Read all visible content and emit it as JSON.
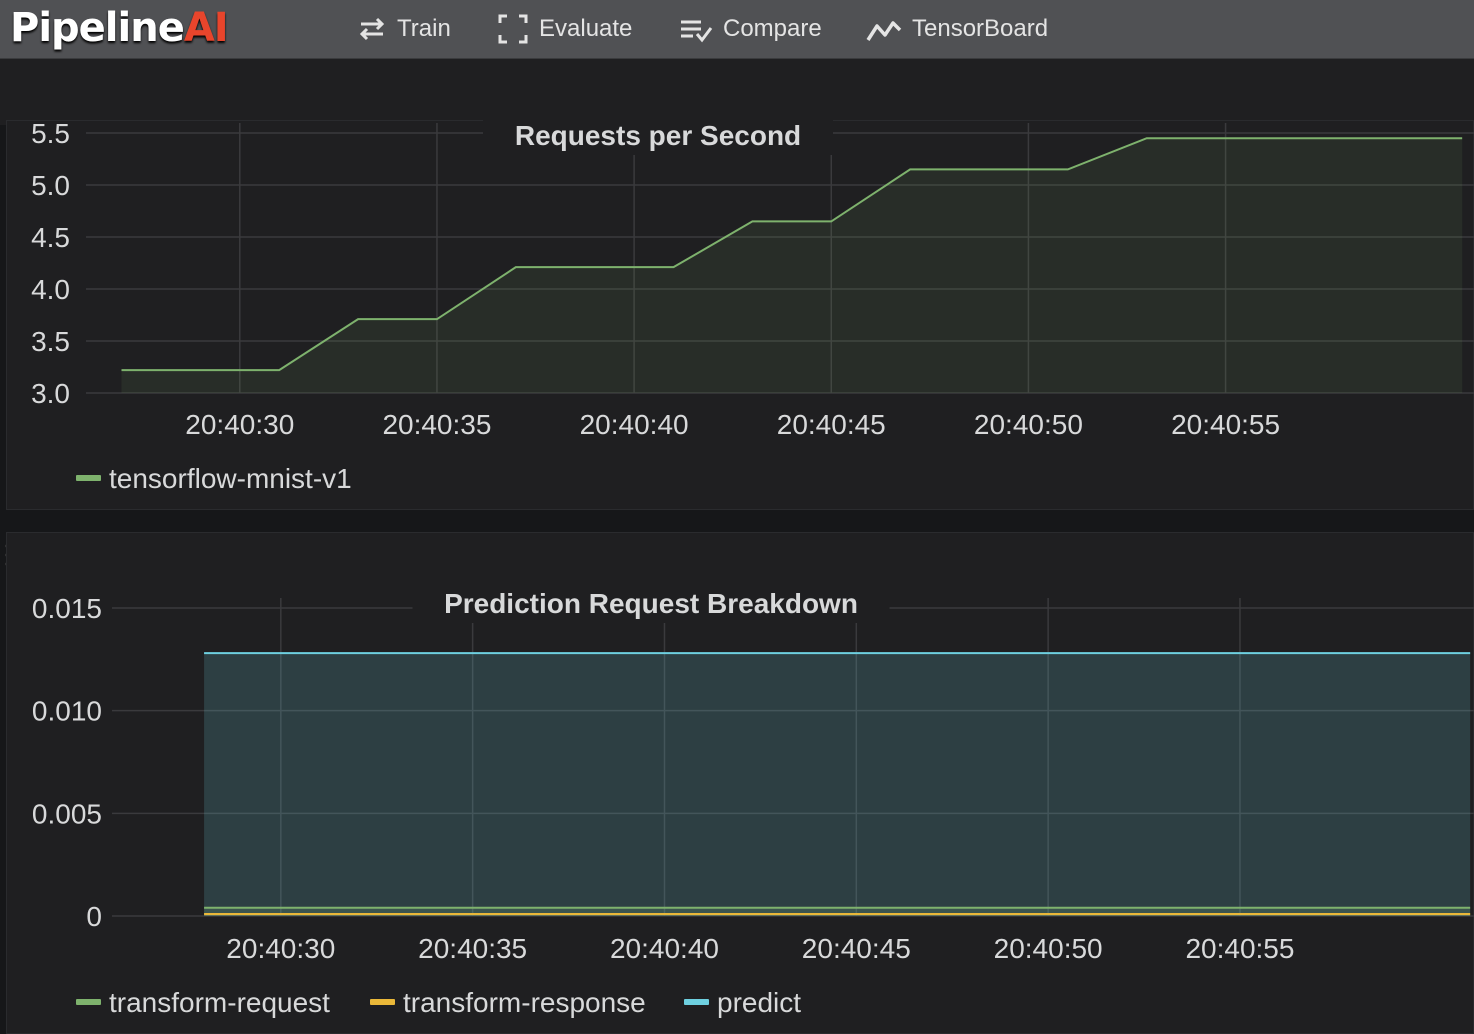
{
  "app": {
    "logo_main": "Pipeline",
    "logo_accent": "AI"
  },
  "nav": {
    "items": [
      {
        "label": "Train",
        "icon": "train-icon"
      },
      {
        "label": "Evaluate",
        "icon": "evaluate-icon"
      },
      {
        "label": "Compare",
        "icon": "compare-icon"
      },
      {
        "label": "TensorBoard",
        "icon": "tensorboard-icon"
      }
    ]
  },
  "colors": {
    "green": "#7eb26d",
    "yellow": "#eab839",
    "blue": "#6ed0e0",
    "grid": "#3a3a3d",
    "text": "#d8d9da"
  },
  "chart_data": [
    {
      "type": "area",
      "title": "Requests per Second",
      "xlabel": "",
      "ylabel": "",
      "x_ticks": [
        "20:40:30",
        "20:40:35",
        "20:40:40",
        "20:40:45",
        "20:40:50",
        "20:40:55"
      ],
      "y_ticks": [
        "3.0",
        "3.5",
        "4.0",
        "4.5",
        "5.0",
        "5.5"
      ],
      "ylim": [
        3.0,
        5.5
      ],
      "xlim_seconds_after_20_40_00": [
        26.1,
        61.3
      ],
      "grid": true,
      "legend_placement": "bottom-left",
      "series": [
        {
          "name": "tensorflow-mnist-v1",
          "color": "#7eb26d",
          "x": [
            "20:40:27",
            "20:40:31",
            "20:40:33",
            "20:40:35",
            "20:40:37",
            "20:40:41",
            "20:40:43",
            "20:40:45",
            "20:40:47",
            "20:40:51",
            "20:40:53",
            "20:40:55",
            "20:41:01"
          ],
          "values": [
            3.22,
            3.22,
            3.71,
            3.71,
            4.21,
            4.21,
            4.65,
            4.65,
            5.15,
            5.15,
            5.45,
            5.45,
            5.45
          ]
        }
      ]
    },
    {
      "type": "area",
      "title": "Prediction Request Breakdown",
      "xlabel": "",
      "ylabel": "",
      "x_ticks": [
        "20:40:30",
        "20:40:35",
        "20:40:40",
        "20:40:45",
        "20:40:50",
        "20:40:55"
      ],
      "y_ticks": [
        "0",
        "0.005",
        "0.010",
        "0.015"
      ],
      "ylim": [
        0,
        0.015
      ],
      "xlim_seconds_after_20_40_00": [
        25.6,
        61.1
      ],
      "grid": true,
      "legend_placement": "bottom-left",
      "series": [
        {
          "name": "transform-request",
          "color": "#7eb26d",
          "x": [
            "20:40:28",
            "20:41:01"
          ],
          "values": [
            0.0004,
            0.0004
          ]
        },
        {
          "name": "transform-response",
          "color": "#eab839",
          "x": [
            "20:40:28",
            "20:41:01"
          ],
          "values": [
            0.0001,
            0.0001
          ]
        },
        {
          "name": "predict",
          "color": "#6ed0e0",
          "x": [
            "20:40:28",
            "20:41:01"
          ],
          "values": [
            0.0128,
            0.0128
          ]
        }
      ]
    }
  ]
}
